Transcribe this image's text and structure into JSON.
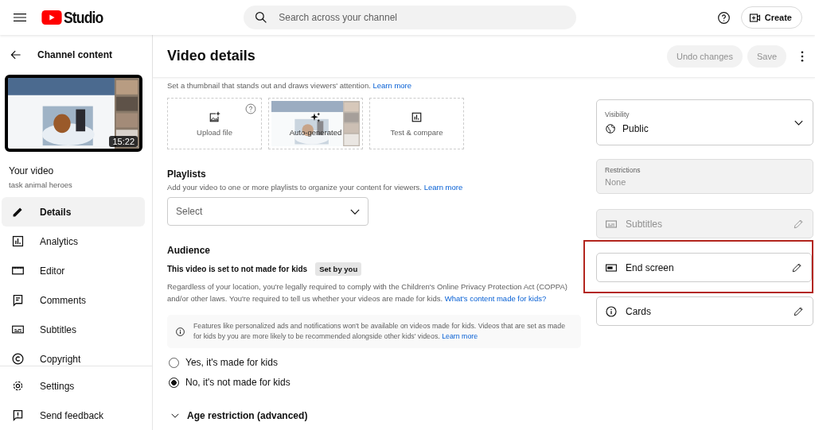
{
  "header": {
    "logo_text": "Studio",
    "search_placeholder": "Search across your channel",
    "create_label": "Create"
  },
  "sidebar": {
    "back_label": "Channel content",
    "video": {
      "duration": "15:22"
    },
    "video_heading": "Your video",
    "video_name": "task animal heroes",
    "nav": [
      {
        "label": "Details",
        "kind": "pencil",
        "selected": true
      },
      {
        "label": "Analytics",
        "kind": "chart",
        "selected": false
      },
      {
        "label": "Editor",
        "kind": "clapper",
        "selected": false
      },
      {
        "label": "Comments",
        "kind": "comment",
        "selected": false
      },
      {
        "label": "Subtitles",
        "kind": "subtitles",
        "selected": false
      },
      {
        "label": "Copyright",
        "kind": "copyright",
        "selected": false
      }
    ],
    "footer": [
      {
        "label": "Settings",
        "kind": "gear"
      },
      {
        "label": "Send feedback",
        "kind": "feedback"
      }
    ]
  },
  "page": {
    "title": "Video details",
    "buttons": [
      {
        "label": "Undo changes",
        "disabled": true
      },
      {
        "label": "Save",
        "disabled": true
      }
    ]
  },
  "thumbnail": {
    "description": "Set a thumbnail that stands out and draws viewers' attention.",
    "link": "Learn more",
    "options": [
      {
        "label": "Upload file",
        "kind": "upload"
      },
      {
        "label": "Auto-generated",
        "kind": "auto"
      },
      {
        "label": "Test & compare",
        "kind": "test"
      }
    ]
  },
  "playlists": {
    "heading": "Playlists",
    "description": "Add your video to one or more playlists to organize your content for viewers.",
    "link": "Learn more",
    "placeholder": "Select"
  },
  "audience": {
    "heading": "Audience",
    "status": "This video is set to not made for kids",
    "badge": "Set by you",
    "text": "Regardless of your location, you're legally required to comply with the Children's Online Privacy Protection Act (COPPA) and/or other laws. You're required to tell us whether your videos are made for kids.",
    "link": "What's content made for kids?",
    "notice": "Features like personalized ads and notifications won't be available on videos made for kids. Videos that are set as made for kids by you are more likely to be recommended alongside other kids' videos.",
    "notice_link": "Learn more",
    "options": [
      {
        "label": "Yes, it's made for kids",
        "selected": false
      },
      {
        "label": "No, it's not made for kids",
        "selected": true
      }
    ],
    "age_restriction": "Age restriction (advanced)"
  },
  "visibility": {
    "label": "Visibility",
    "value": "Public"
  },
  "restrictions": {
    "label": "Restrictions",
    "value": "None"
  },
  "features": [
    {
      "label": "Subtitles",
      "kind": "subtitles",
      "disabled": true,
      "highlighted": false
    },
    {
      "label": "End screen",
      "kind": "endscreen",
      "disabled": false,
      "highlighted": true
    },
    {
      "label": "Cards",
      "kind": "info",
      "disabled": false,
      "highlighted": false
    }
  ]
}
